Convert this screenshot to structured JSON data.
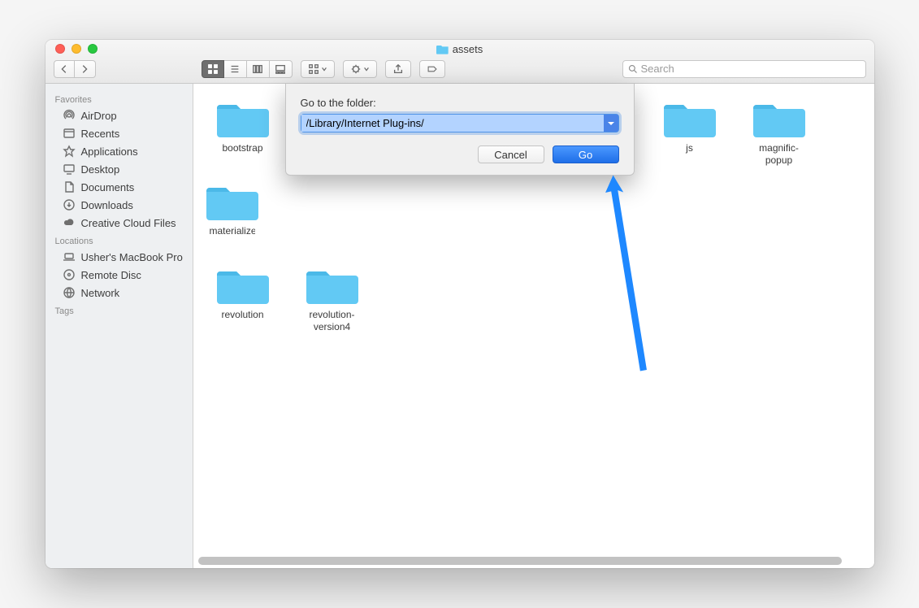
{
  "window": {
    "title": "assets"
  },
  "search": {
    "placeholder": "Search"
  },
  "sidebar": {
    "sections": {
      "favorites": {
        "header": "Favorites",
        "items": [
          {
            "label": "AirDrop"
          },
          {
            "label": "Recents"
          },
          {
            "label": "Applications"
          },
          {
            "label": "Desktop"
          },
          {
            "label": "Documents"
          },
          {
            "label": "Downloads"
          },
          {
            "label": "Creative Cloud Files"
          }
        ]
      },
      "locations": {
        "header": "Locations",
        "items": [
          {
            "label": "Usher's MacBook Pro"
          },
          {
            "label": "Remote Disc"
          },
          {
            "label": "Network"
          }
        ]
      },
      "tags": {
        "header": "Tags"
      }
    }
  },
  "files": [
    {
      "name": "bootstrap"
    },
    {
      "name": "js"
    },
    {
      "name": "magnific-popup"
    },
    {
      "name": "materialize"
    },
    {
      "name": "revolution"
    },
    {
      "name": "revolution-version4"
    }
  ],
  "dialog": {
    "label": "Go to the folder:",
    "path": "/Library/Internet Plug-ins/",
    "cancel": "Cancel",
    "go": "Go"
  },
  "colors": {
    "folder": "#62c9f4",
    "accent": "#2a7bf0"
  }
}
